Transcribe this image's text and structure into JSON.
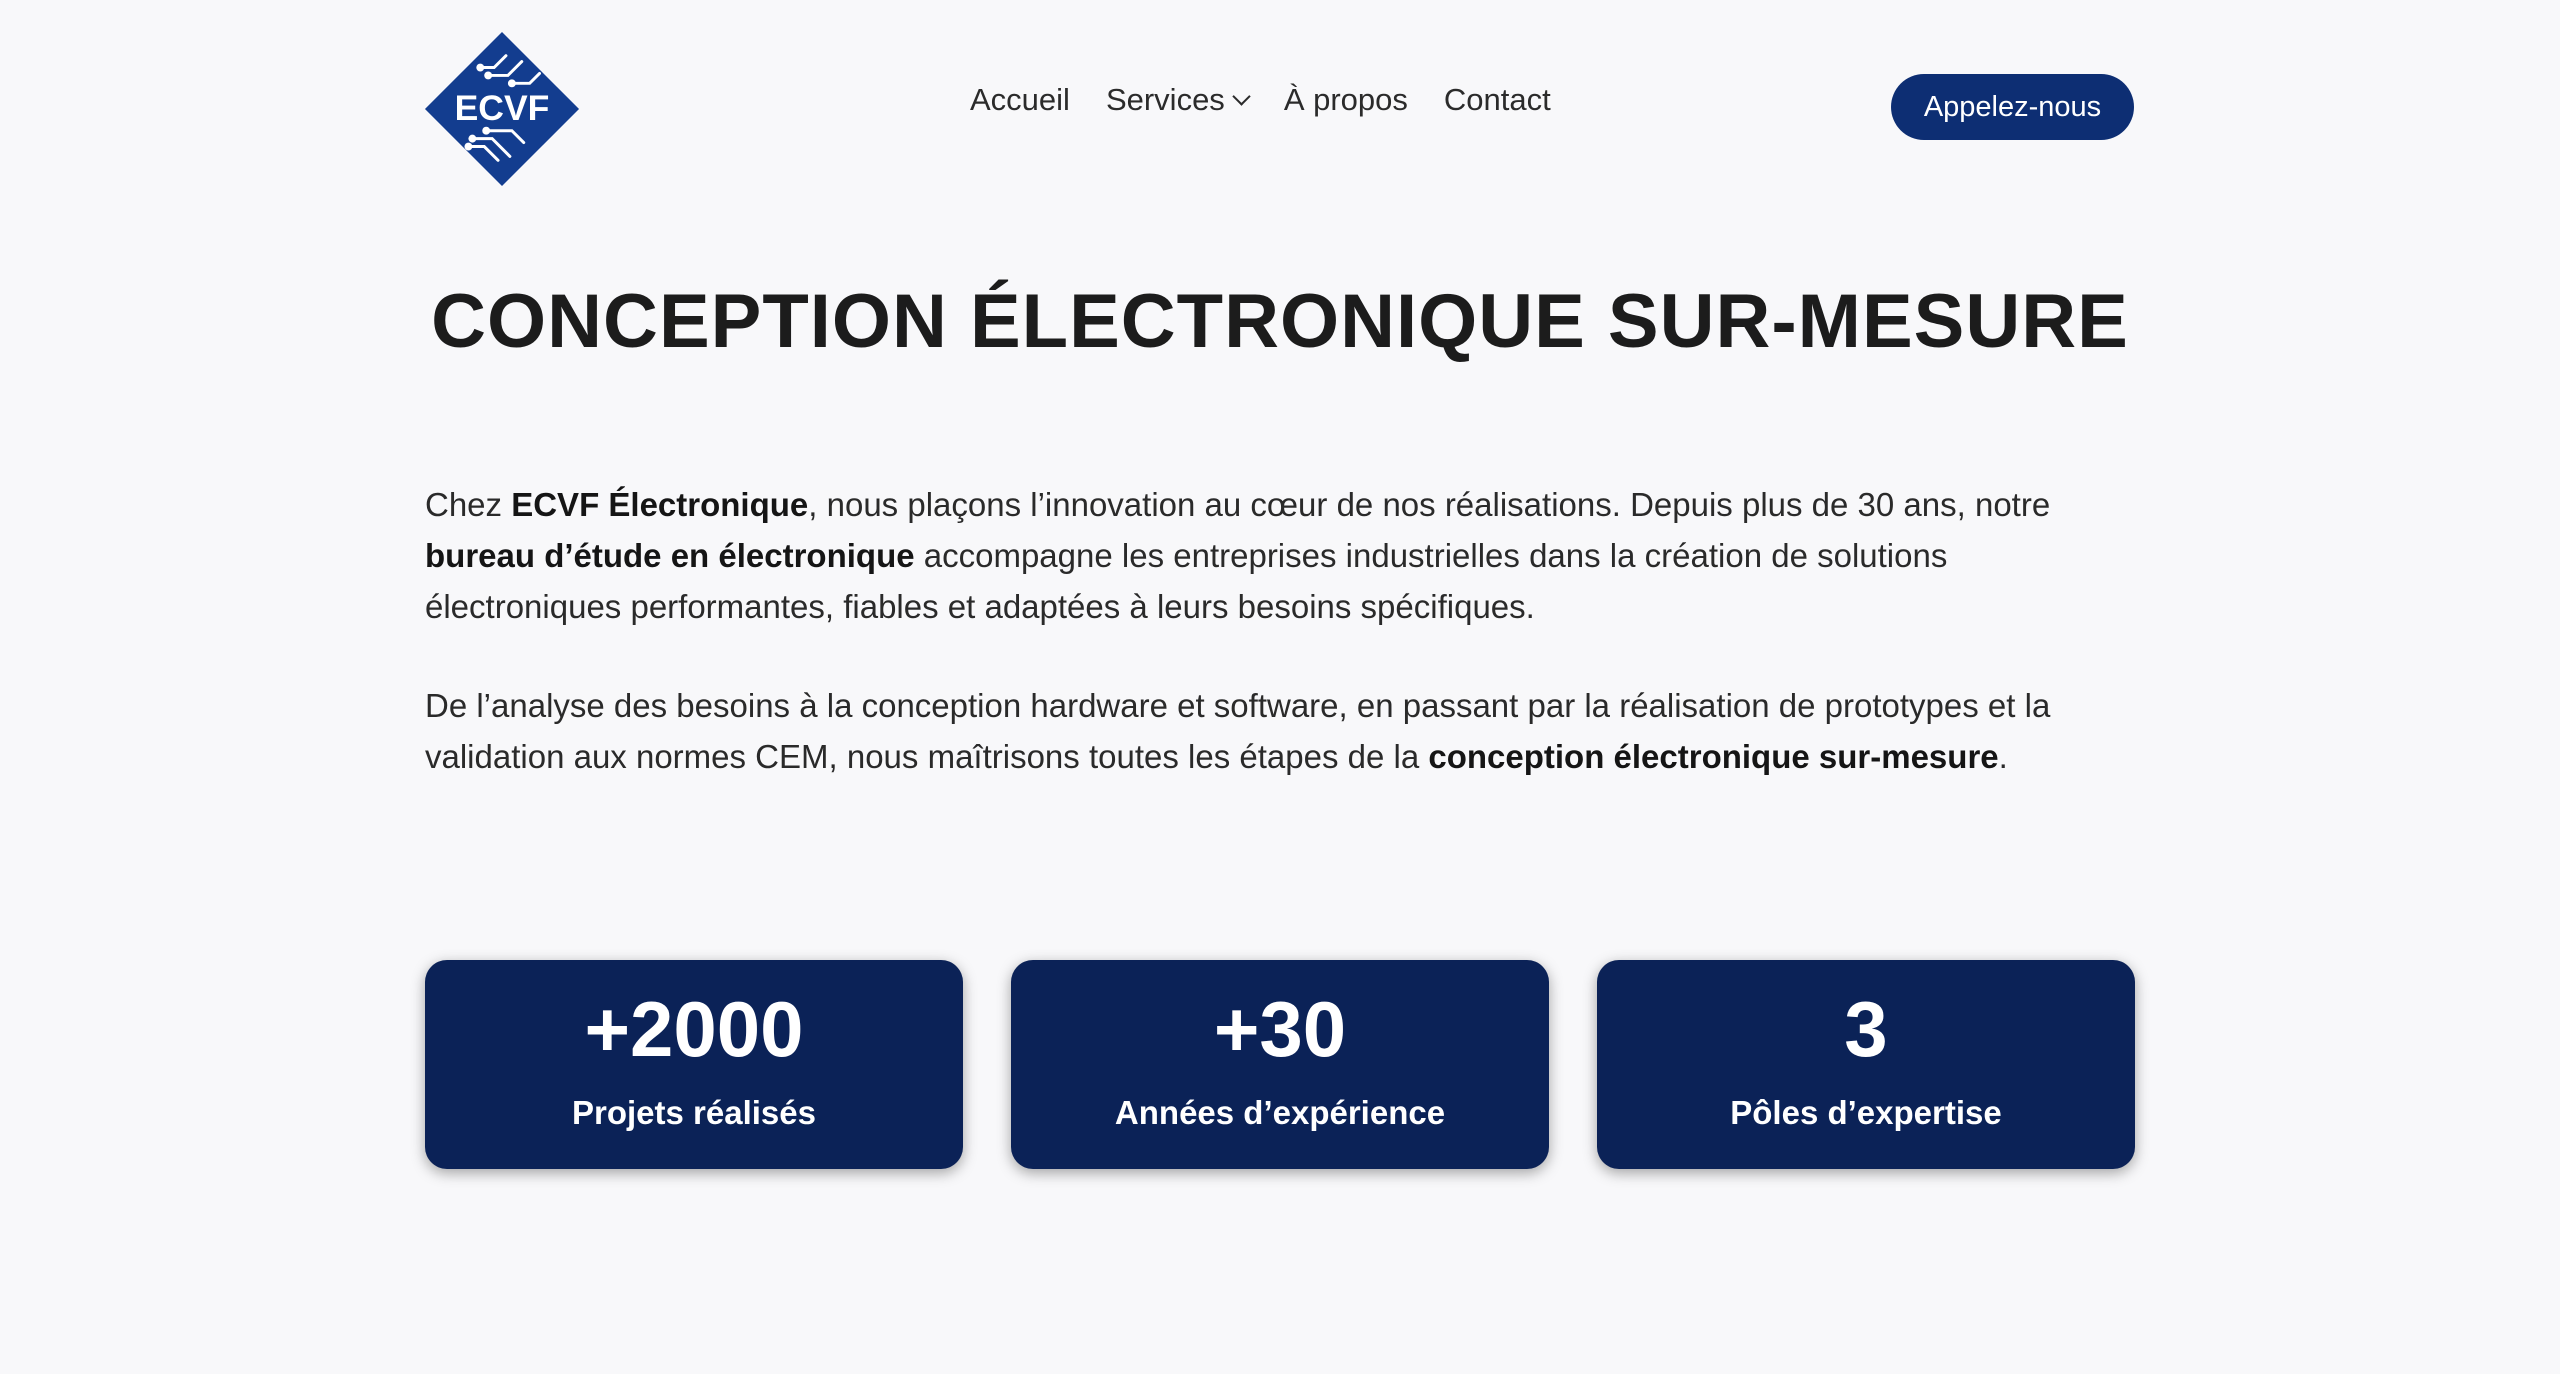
{
  "header": {
    "logo_text": "ECVF",
    "nav": [
      {
        "label": "Accueil"
      },
      {
        "label": "Services"
      },
      {
        "label": "À propos"
      },
      {
        "label": "Contact"
      }
    ],
    "cta_label": "Appelez-nous"
  },
  "hero": {
    "title": "CONCEPTION ÉLECTRONIQUE SUR-MESURE"
  },
  "intro": {
    "p1": {
      "t1": "Chez ",
      "b1": "ECVF Électronique",
      "t2": ", nous plaçons l’innovation au cœur de nos réalisations. Depuis plus de 30 ans, notre ",
      "b2": "bureau d’étude en électronique",
      "t3": " accompagne les entreprises industrielles dans la création de solutions électroniques performantes, fiables et adaptées à leurs besoins spécifiques."
    },
    "p2": {
      "t1": "De l’analyse des besoins à la conception hardware et software, en passant par la réalisation de prototypes et la validation aux normes CEM, nous maîtrisons toutes les étapes de la ",
      "b1": "conception électronique sur-mesure",
      "t2": "."
    }
  },
  "stats": [
    {
      "value": "+2000",
      "label": "Projets réalisés"
    },
    {
      "value": "+30",
      "label": "Années d’expérience"
    },
    {
      "value": "3",
      "label": "Pôles d’expertise"
    }
  ],
  "colors": {
    "brand_navy": "#0d2e73",
    "card_navy": "#0b2257",
    "background": "#f8f8fa"
  }
}
